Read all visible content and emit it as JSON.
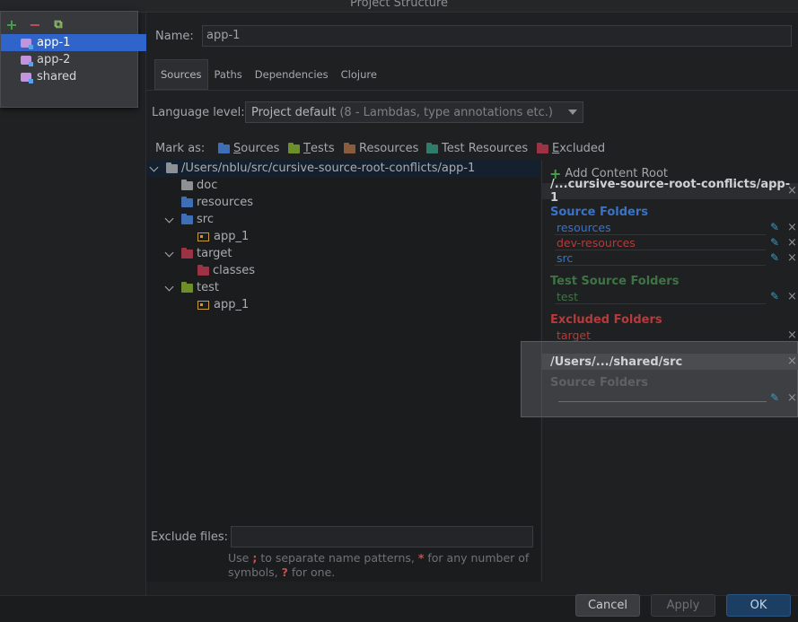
{
  "window": {
    "title": "Project Structure"
  },
  "modules": [
    {
      "label": "app-1",
      "selected": true
    },
    {
      "label": "app-2",
      "selected": false
    },
    {
      "label": "shared",
      "selected": false
    }
  ],
  "name_field": {
    "label": "Name:",
    "value": "app-1"
  },
  "tabs": [
    {
      "label": "Sources",
      "active": true
    },
    {
      "label": "Paths"
    },
    {
      "label": "Dependencies"
    },
    {
      "label": "Clojure"
    }
  ],
  "language_level": {
    "label": "Language level:",
    "value": "Project default",
    "hint": "(8 - Lambdas, type annotations etc.)"
  },
  "mark_as": {
    "label": "Mark as:",
    "buttons": [
      {
        "label": "Sources",
        "mnemonic": "S",
        "rest": "ources"
      },
      {
        "label": "Tests",
        "mnemonic": "T",
        "rest": "ests"
      },
      {
        "label": "Resources",
        "mnemonic": "",
        "rest": "Resources"
      },
      {
        "label": "Test Resources",
        "mnemonic": "",
        "rest": "Test Resources"
      },
      {
        "label": "Excluded",
        "mnemonic": "E",
        "rest": "xcluded"
      }
    ]
  },
  "tree": [
    {
      "label": "/Users/nblu/src/cursive-source-root-conflicts/app-1",
      "type": "root"
    },
    {
      "label": "doc",
      "type": "folder"
    },
    {
      "label": "resources",
      "type": "source"
    },
    {
      "label": "src",
      "type": "source"
    },
    {
      "label": "app_1",
      "type": "package"
    },
    {
      "label": "target",
      "type": "excluded"
    },
    {
      "label": "classes",
      "type": "excluded"
    },
    {
      "label": "test",
      "type": "test"
    },
    {
      "label": "app_1",
      "type": "package"
    }
  ],
  "content_roots": {
    "add_label": "Add Content Root",
    "root1": {
      "path": "/...cursive-source-root-conflicts/app-1",
      "source_title": "Source Folders",
      "sources": [
        "resources",
        "dev-resources",
        "src"
      ],
      "test_title": "Test Source Folders",
      "tests": [
        "test"
      ],
      "excluded_title": "Excluded Folders",
      "excluded": [
        "target"
      ]
    },
    "root2": {
      "path": "/Users/.../shared/src",
      "source_title": "Source Folders"
    }
  },
  "exclude_files": {
    "label": "Exclude files:",
    "help_1": "Use",
    "help_sep": ";",
    "help_2": "to separate name patterns,",
    "help_star": "*",
    "help_3": "for any number of symbols,",
    "help_q": "?",
    "help_4": "for one."
  },
  "buttons": {
    "cancel": "Cancel",
    "apply": "Apply",
    "ok": "OK"
  },
  "icons": {
    "close": "×",
    "edit": "✎",
    "plus": "+",
    "minus": "−"
  },
  "colors": {
    "selection": "#2f65ca",
    "source_blue": "#3a72c6",
    "test_green": "#3f7346",
    "excluded_red": "#b63a3a",
    "ok_button": "#1c3e63"
  }
}
